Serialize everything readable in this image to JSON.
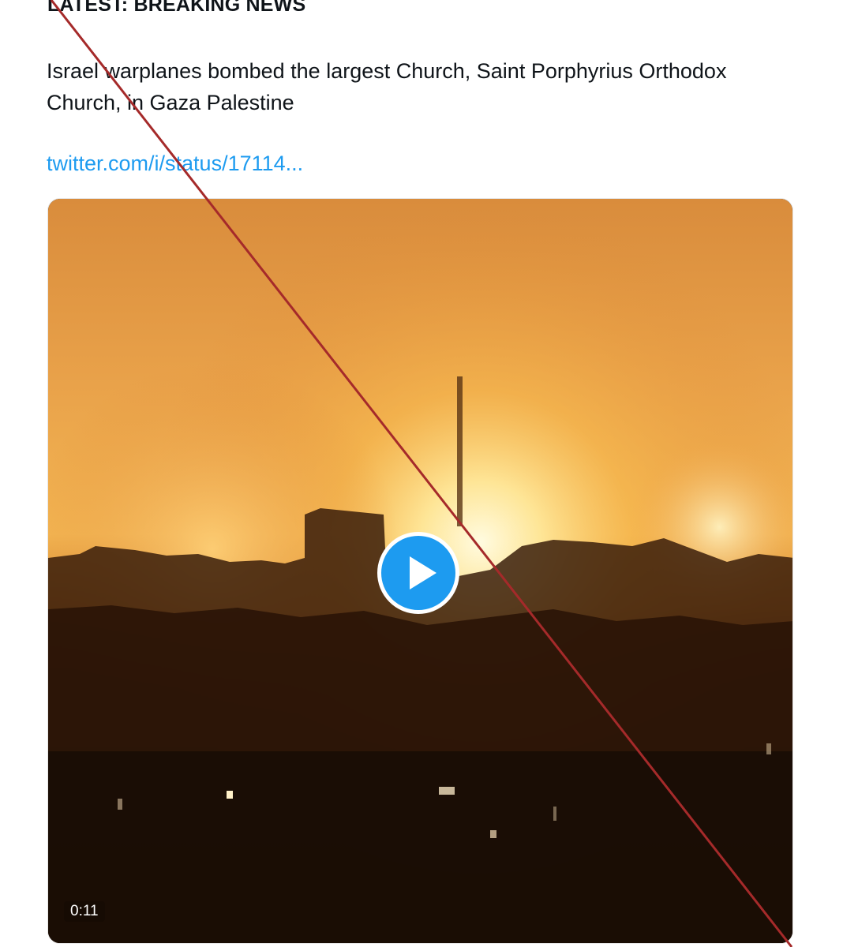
{
  "post": {
    "headline": "LATEST: BREAKING NEWS",
    "body_line_1": "Israel warplanes bombed the largest Church, Saint Porphyrius Orthodox",
    "body_line_2": "Church, in Gaza Palestine",
    "link_text": "twitter.com/i/status/17114..."
  },
  "video": {
    "duration": "0:11",
    "play_icon": "play-icon"
  },
  "colors": {
    "link": "#1d9bf0",
    "play_button": "#1d9bf0",
    "overlay_line": "#a52a2a",
    "text": "#0f1419"
  }
}
